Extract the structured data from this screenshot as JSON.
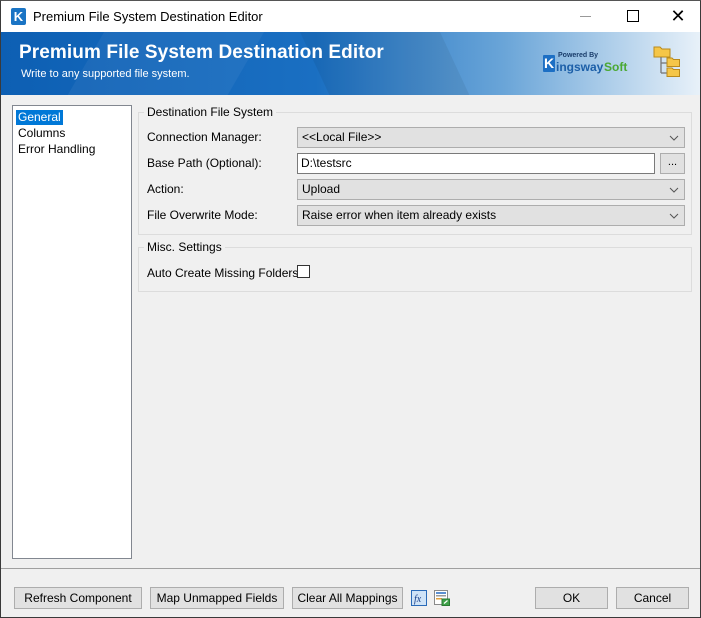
{
  "window": {
    "title": "Premium File System Destination Editor",
    "app_icon_letter": "K",
    "controls": {
      "minimize": "minimize",
      "maximize": "maximize",
      "close": "✕"
    }
  },
  "banner": {
    "title": "Premium File System Destination Editor",
    "subtitle": "Write to any supported file system.",
    "logo": {
      "k": "K",
      "powered_by": "Powered By",
      "word1": "ingsway",
      "word2": "Soft"
    }
  },
  "nav": {
    "items": [
      {
        "label": "General",
        "selected": true
      },
      {
        "label": "Columns",
        "selected": false
      },
      {
        "label": "Error Handling",
        "selected": false
      }
    ]
  },
  "destination_group": {
    "title": "Destination File System",
    "connection_manager": {
      "label": "Connection Manager:",
      "value": "<<Local File>>"
    },
    "base_path": {
      "label": "Base Path (Optional):",
      "value": "D:\\testsrc",
      "browse_label": "..."
    },
    "action": {
      "label": "Action:",
      "value": "Upload"
    },
    "overwrite_mode": {
      "label": "File Overwrite Mode:",
      "value": "Raise error when item already exists"
    }
  },
  "misc_group": {
    "title": "Misc. Settings",
    "auto_create": {
      "label": "Auto Create Missing Folders:",
      "checked": false
    }
  },
  "footer": {
    "refresh": "Refresh Component",
    "map_unmapped": "Map Unmapped Fields",
    "clear_mappings": "Clear All Mappings",
    "fx_icon_text": "fx",
    "ok": "OK",
    "cancel": "Cancel"
  }
}
